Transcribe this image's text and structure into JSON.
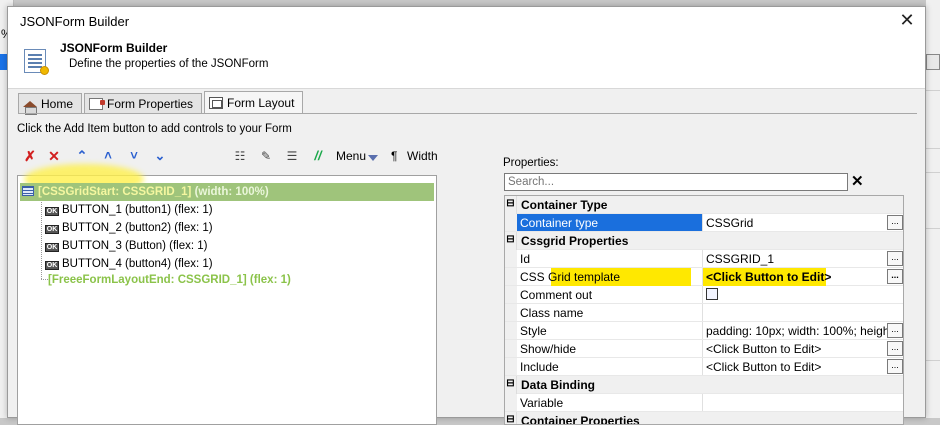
{
  "background": {
    "left_text": "%"
  },
  "dialog": {
    "title": "JSONForm Builder",
    "header_title": "JSONForm Builder",
    "header_subtitle": "Define the properties of the JSONForm",
    "close_glyph": "✕"
  },
  "tabs": [
    {
      "label": "Home",
      "icon": "home-icon",
      "active": false
    },
    {
      "label": "Form Properties",
      "icon": "form-properties-icon",
      "active": false
    },
    {
      "label": "Form Layout",
      "icon": "form-layout-icon",
      "active": true
    }
  ],
  "instruction": "Click the Add Item button to add controls to your Form",
  "toolbar": {
    "menu_label": "Menu",
    "pilcrow": "¶",
    "width_label": "Width",
    "icons": [
      "delete-all-icon",
      "delete-icon",
      "move-top-icon",
      "move-up-icon",
      "move-down-icon",
      "move-bottom-icon",
      "add-item-icon",
      "edit-icon",
      "list-icon",
      "comment-icon",
      "menu-dropdown-icon"
    ]
  },
  "tree": {
    "root": {
      "name": "[CSSGridStart: CSSGRID_1]",
      "suffix": "(width: 100%)"
    },
    "children": [
      {
        "badge": "OK",
        "label": "BUTTON_1 (button1) (flex: 1)"
      },
      {
        "badge": "OK",
        "label": "BUTTON_2 (button2) (flex: 1)"
      },
      {
        "badge": "OK",
        "label": "BUTTON_3 (Button) (flex: 1)"
      },
      {
        "badge": "OK",
        "label": "BUTTON_4 (button4) (flex: 1)"
      }
    ],
    "end": "[FreeeFormLayoutEnd: CSSGRID_1] (flex: 1)"
  },
  "properties": {
    "label": "Properties:",
    "search_placeholder": "Search...",
    "clear_glyph": "✕",
    "rows": {
      "cat_container_type": "Container Type",
      "container_type_name": "Container type",
      "container_type_value": "CSSGrid",
      "cat_cssgrid": "Cssgrid Properties",
      "id_name": "Id",
      "id_value": "CSSGRID_1",
      "template_name": "CSS Grid template",
      "template_value": "<Click Button to Edit>",
      "comment_name": "Comment out",
      "classname_name": "Class name",
      "classname_value": "",
      "style_name": "Style",
      "style_value": "padding: 10px; width: 100%; height:",
      "showhide_name": "Show/hide",
      "showhide_value": "<Click Button to Edit>",
      "include_name": "Include",
      "include_value": "<Click Button to Edit>",
      "cat_data_binding": "Data Binding",
      "variable_name": "Variable",
      "variable_value": "",
      "cat_container_props": "Container Properties"
    },
    "ellipsis": "..."
  },
  "colors": {
    "root_row_bg": "#9fc47b",
    "selection_blue": "#1a6fdd",
    "highlight_yellow": "#ffe800",
    "end_row_green": "#8bc34a"
  }
}
